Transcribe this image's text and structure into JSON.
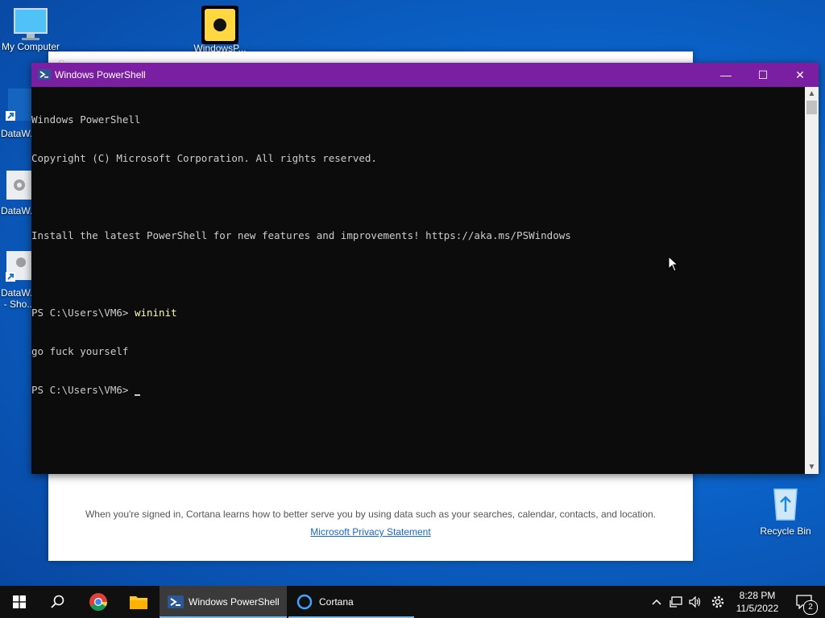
{
  "desktop": {
    "icons": [
      {
        "label": "My Computer",
        "icon": "monitor-icon"
      },
      {
        "label": "WindowsP...",
        "icon": "app-icon"
      },
      {
        "label": "DataW...",
        "icon": "shortcut-icon"
      },
      {
        "label": "DataW...",
        "icon": "settings-icon"
      },
      {
        "label": "DataW...",
        "label2": "- Sho...",
        "icon": "shortcut-icon"
      },
      {
        "label": "Recycle Bin",
        "icon": "recycle-bin-icon"
      }
    ]
  },
  "cortana": {
    "ghost_title": "C...",
    "notice": "When you're signed in, Cortana learns how to better serve you by using data such as your searches, calendar, contacts, and location.",
    "privacy_link": "Microsoft Privacy Statement"
  },
  "powershell": {
    "title": "Windows PowerShell",
    "lines": [
      {
        "text": "Windows PowerShell"
      },
      {
        "text": "Copyright (C) Microsoft Corporation. All rights reserved."
      },
      {
        "text": ""
      },
      {
        "text": "Install the latest PowerShell for new features and improvements! https://aka.ms/PSWindows"
      },
      {
        "text": ""
      },
      {
        "prompt": "PS C:\\Users\\VM6> ",
        "cmd": "wininit"
      },
      {
        "text": "go fuck yourself"
      },
      {
        "prompt": "PS C:\\Users\\VM6> ",
        "cmd": ""
      }
    ],
    "buttons": {
      "minimize": "—",
      "maximize": "☐",
      "close": "✕"
    }
  },
  "taskbar": {
    "apps": [
      {
        "label": "Windows PowerShell",
        "active": true
      },
      {
        "label": "Cortana",
        "active": false
      }
    ],
    "clock": {
      "time": "8:28 PM",
      "date": "11/5/2022"
    },
    "notification_count": "2"
  },
  "colors": {
    "title_bar": "#7b1fa2",
    "console_bg": "#0c0c0c",
    "taskbar": "#101010"
  }
}
